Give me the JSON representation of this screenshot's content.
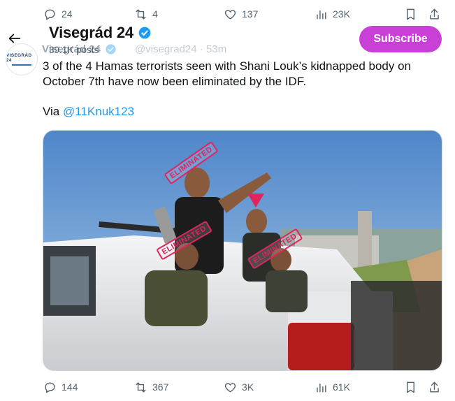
{
  "top_actions": {
    "replies": "24",
    "reposts": "4",
    "likes": "137",
    "views": "23K"
  },
  "header": {
    "name": "Visegrád 24",
    "posts": "39.1K posts",
    "subscribe_label": "Subscribe"
  },
  "ghost_row": {
    "name": "Visegrád 24",
    "handle_time": "@visegrad24 · 53m"
  },
  "avatar": {
    "text": "VISEGRÁD 24"
  },
  "tweet": {
    "line1": "3 of the 4 Hamas terrorists seen with Shani Louk’s kidnapped body on",
    "line2": "October 7th have now been eliminated by the IDF.",
    "via_prefix": "Via ",
    "mention": "@11Knuk123"
  },
  "media": {
    "stamp_label": "ELIMINATED",
    "marker_color": "#e0245e"
  },
  "bottom_actions": {
    "replies": "144",
    "reposts": "367",
    "likes": "3K",
    "views": "61K"
  },
  "colors": {
    "accent": "#1d9bf0",
    "subscribe": "#c940d6",
    "muted": "#536471"
  }
}
